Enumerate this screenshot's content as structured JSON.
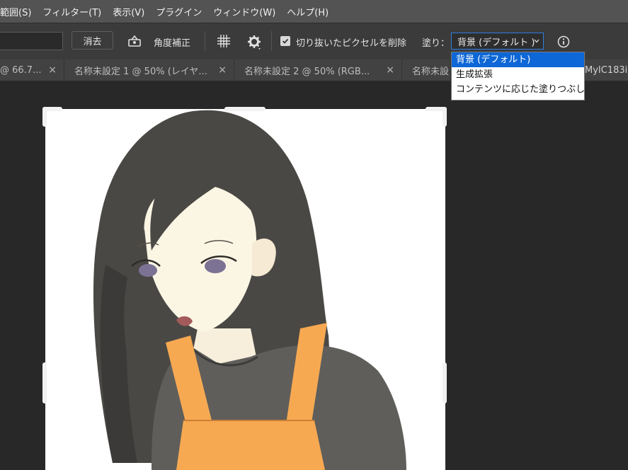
{
  "menubar": {
    "items": [
      "範囲(S)",
      "フィルター(T)",
      "表示(V)",
      "プラグイン",
      "ウィンドウ(W)",
      "ヘルプ(H)"
    ]
  },
  "options": {
    "clear_button": "消去",
    "straighten_label": "角度補正",
    "grid_icon": "grid-overlay-icon",
    "settings_icon": "gear-icon",
    "delete_cropped_label": "切り抜いたピクセルを削除",
    "delete_cropped_checked": true,
    "fill_label": "塗り：",
    "fill_selected": "背景 (デフォルト )",
    "info_icon": "info-icon"
  },
  "fill_dropdown": {
    "options": [
      "背景 (デフォルト)",
      "生成拡張",
      "コンテンツに応じた塗りつぶし"
    ],
    "selected_index": 0
  },
  "tabs": [
    {
      "label": "@ 66.7..."
    },
    {
      "label": "名称未設定 1 @ 50% (レイヤ..."
    },
    {
      "label": "名称未設定 2 @ 50% (RGB..."
    },
    {
      "label": "名称未設"
    },
    {
      "label": "MyIC183i"
    }
  ],
  "colors": {
    "accent": "#0d67d6",
    "menubar_bg": "#535353",
    "canvas_bg": "#282828"
  }
}
